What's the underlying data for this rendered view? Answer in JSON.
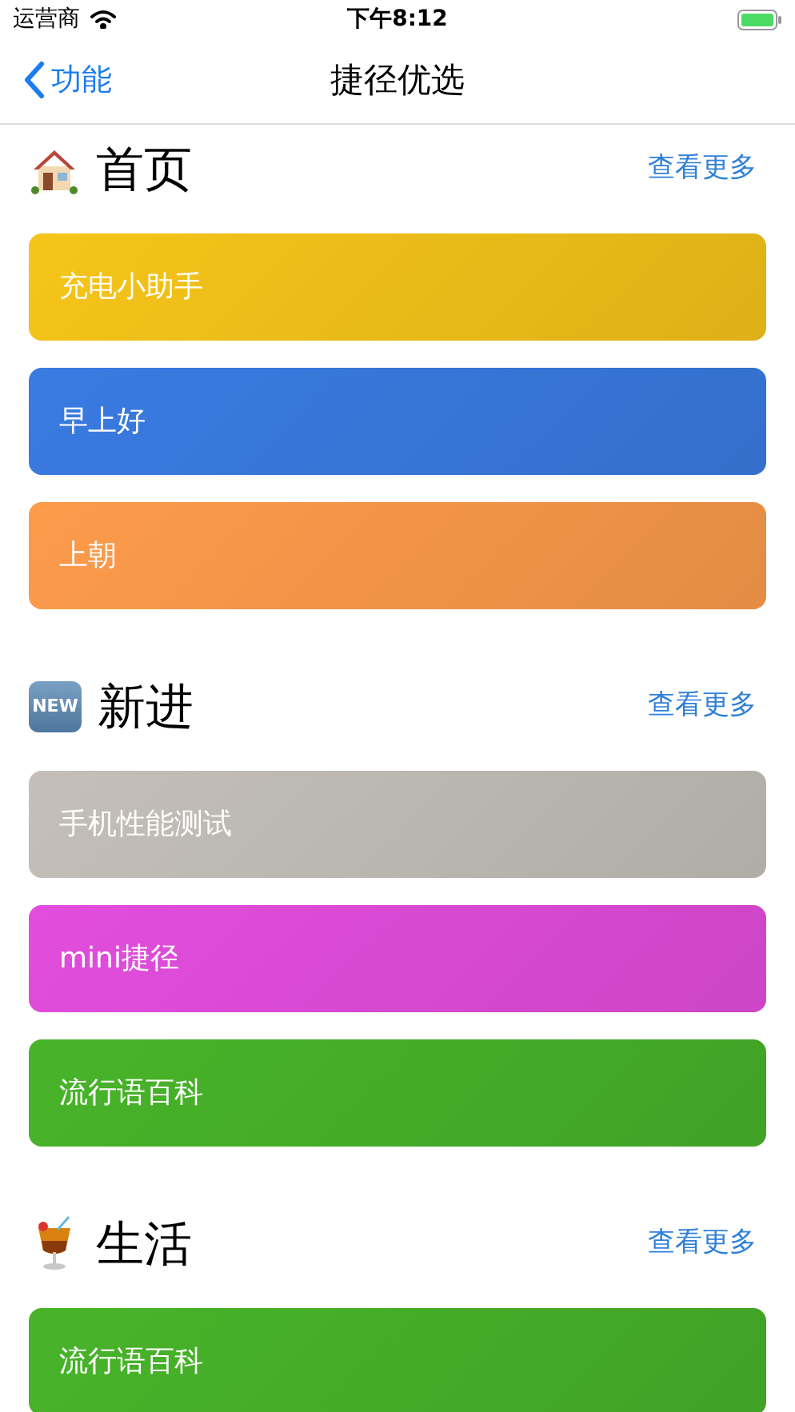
{
  "status_bar": {
    "carrier": "运营商",
    "time": "下午8:12"
  },
  "nav": {
    "back": "功能",
    "title": "捷径优选"
  },
  "sections": [
    {
      "kind": "house",
      "title": "首页",
      "more": "查看更多",
      "cards": [
        {
          "label": "充电小助手",
          "color": "#f6c51a"
        },
        {
          "label": "早上好",
          "color": "#3a7be2"
        },
        {
          "label": "上朝",
          "color": "#fd9b4b"
        }
      ]
    },
    {
      "kind": "new",
      "badge": "NEW",
      "title": "新进",
      "more": "查看更多",
      "cards": [
        {
          "label": "手机性能测试",
          "color": "#c4c0b9"
        },
        {
          "label": "mini捷径",
          "color": "#e34ddd"
        },
        {
          "label": "流行语百科",
          "color": "#48b42a"
        }
      ]
    },
    {
      "kind": "drink",
      "title": "生活",
      "more": "查看更多",
      "cards": [
        {
          "label": "流行语百科",
          "color": "#48b42a"
        }
      ]
    }
  ]
}
